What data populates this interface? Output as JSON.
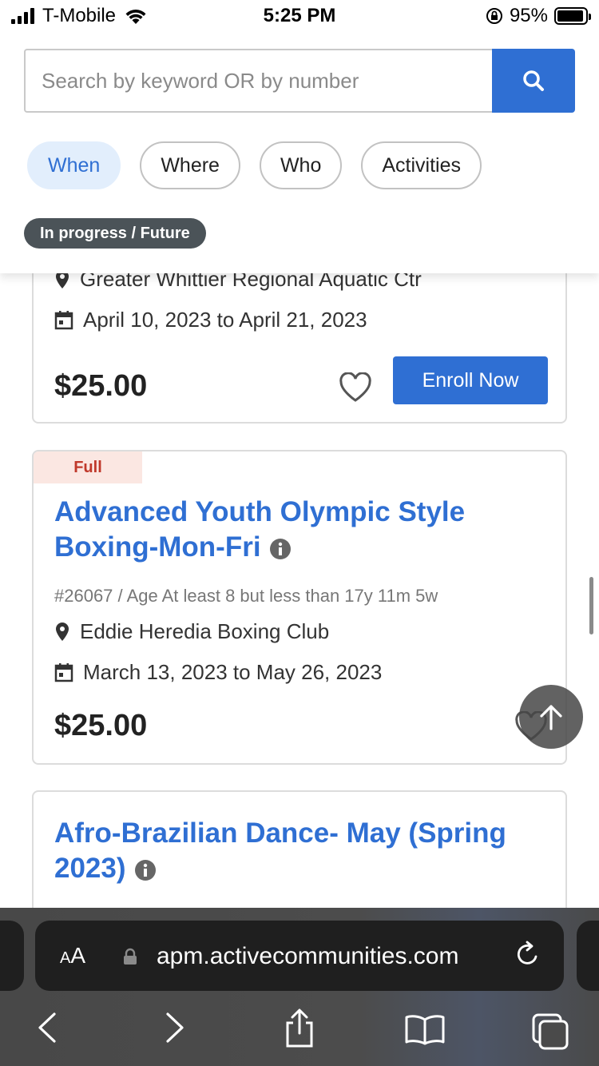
{
  "status_bar": {
    "carrier": "T-Mobile",
    "time": "5:25 PM",
    "battery": "95%",
    "battery_level": 0.95
  },
  "search": {
    "placeholder": "Search by keyword OR by number",
    "value": ""
  },
  "filters": {
    "chips": [
      "When",
      "Where",
      "Who",
      "Activities"
    ],
    "active_chip": "When"
  },
  "active_tag": "In progress / Future",
  "cards": [
    {
      "location": "Greater Whittier Regional Aquatic Ctr",
      "dates": "April 10, 2023 to April 21, 2023",
      "price": "$25.00",
      "button": "Enroll Now"
    },
    {
      "status": "Full",
      "title": "Advanced Youth Olympic Style Boxing-Mon-Fri",
      "number": "#26067",
      "age": "Age At least 8 but less than 17y 11m 5w",
      "location": "Eddie Heredia Boxing Club",
      "dates": "March 13, 2023 to May 26, 2023",
      "price": "$25.00"
    },
    {
      "title": "Afro-Brazilian Dance- May (Spring 2023)"
    }
  ],
  "browser": {
    "text_size_label": "AA",
    "url": "apm.activecommunities.com"
  },
  "colors": {
    "accent": "#2f6fd3",
    "full_tag_bg": "#fbe7e2",
    "full_tag_text": "#c0392b",
    "tag_pill": "#4b5358"
  }
}
